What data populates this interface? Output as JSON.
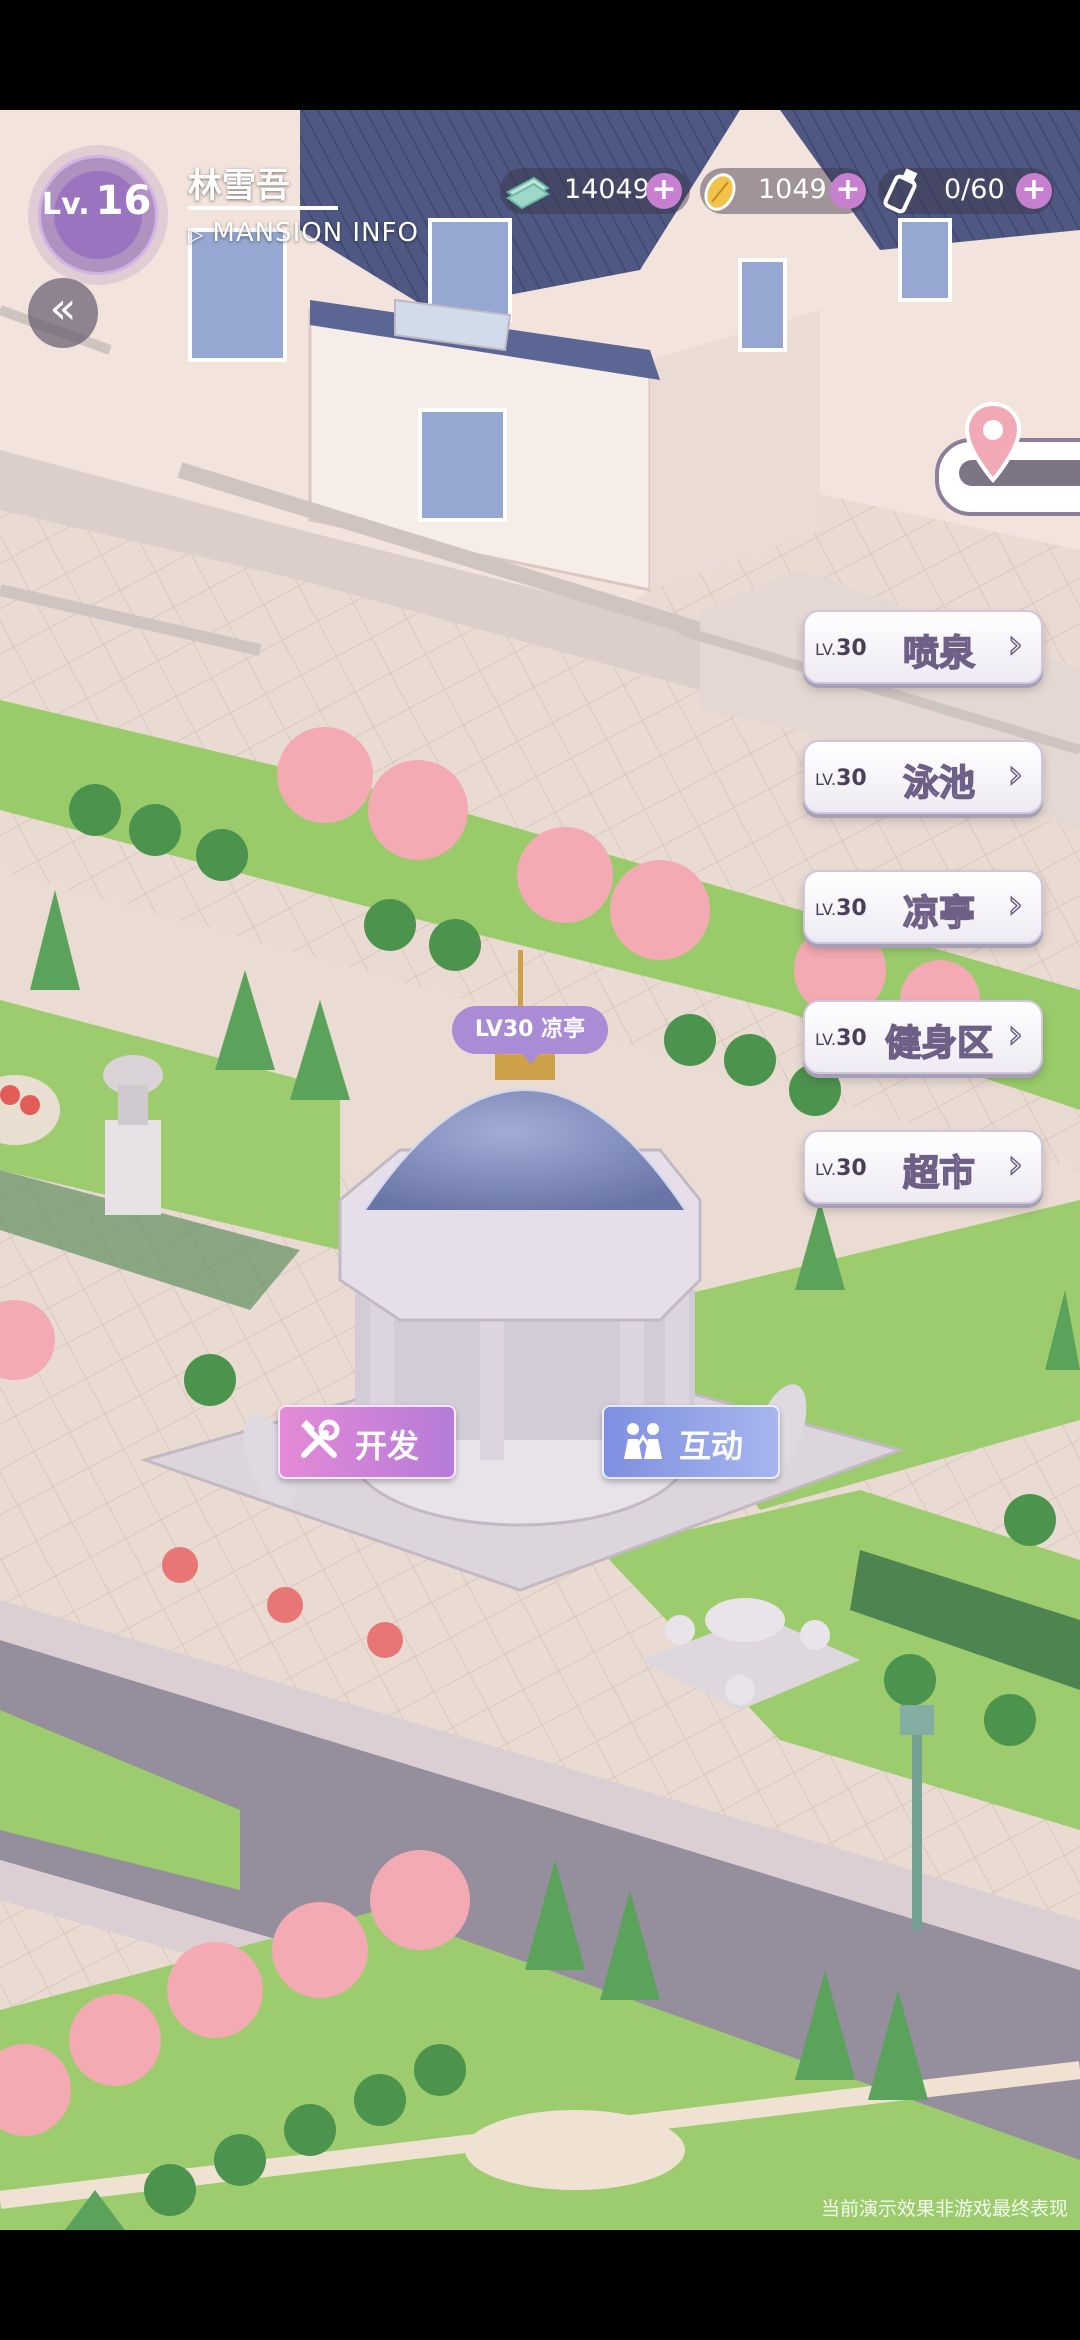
{
  "hud": {
    "level_prefix": "Lv.",
    "level_value": "16",
    "player_name": "林雪吾",
    "mansion_info": "MANSION INFO",
    "resources": [
      {
        "icon": "cash-icon",
        "value": "14049"
      },
      {
        "icon": "leaf-coin-icon",
        "value": "1049"
      },
      {
        "icon": "stamina-bottle-icon",
        "value": "0/60"
      }
    ],
    "plus": "+"
  },
  "nav": {
    "back": "«"
  },
  "facilities": [
    {
      "lv_prefix": "LV.",
      "lv": "30",
      "name": "喷泉"
    },
    {
      "lv_prefix": "LV.",
      "lv": "30",
      "name": "泳池"
    },
    {
      "lv_prefix": "LV.",
      "lv": "30",
      "name": "凉亭"
    },
    {
      "lv_prefix": "LV.",
      "lv": "30",
      "name": "健身区"
    },
    {
      "lv_prefix": "LV.",
      "lv": "30",
      "name": "超市"
    }
  ],
  "chevron": "›",
  "selected_building": {
    "bubble": "LV30 凉亭"
  },
  "actions": {
    "develop": "开发",
    "interact": "互动"
  },
  "disclaimer": "当前演示效果非游戏最终表现",
  "colors": {
    "accent_purple": "#a98bd6",
    "plus_pink": "#c77fd0",
    "lawn": "#8cc35a"
  }
}
